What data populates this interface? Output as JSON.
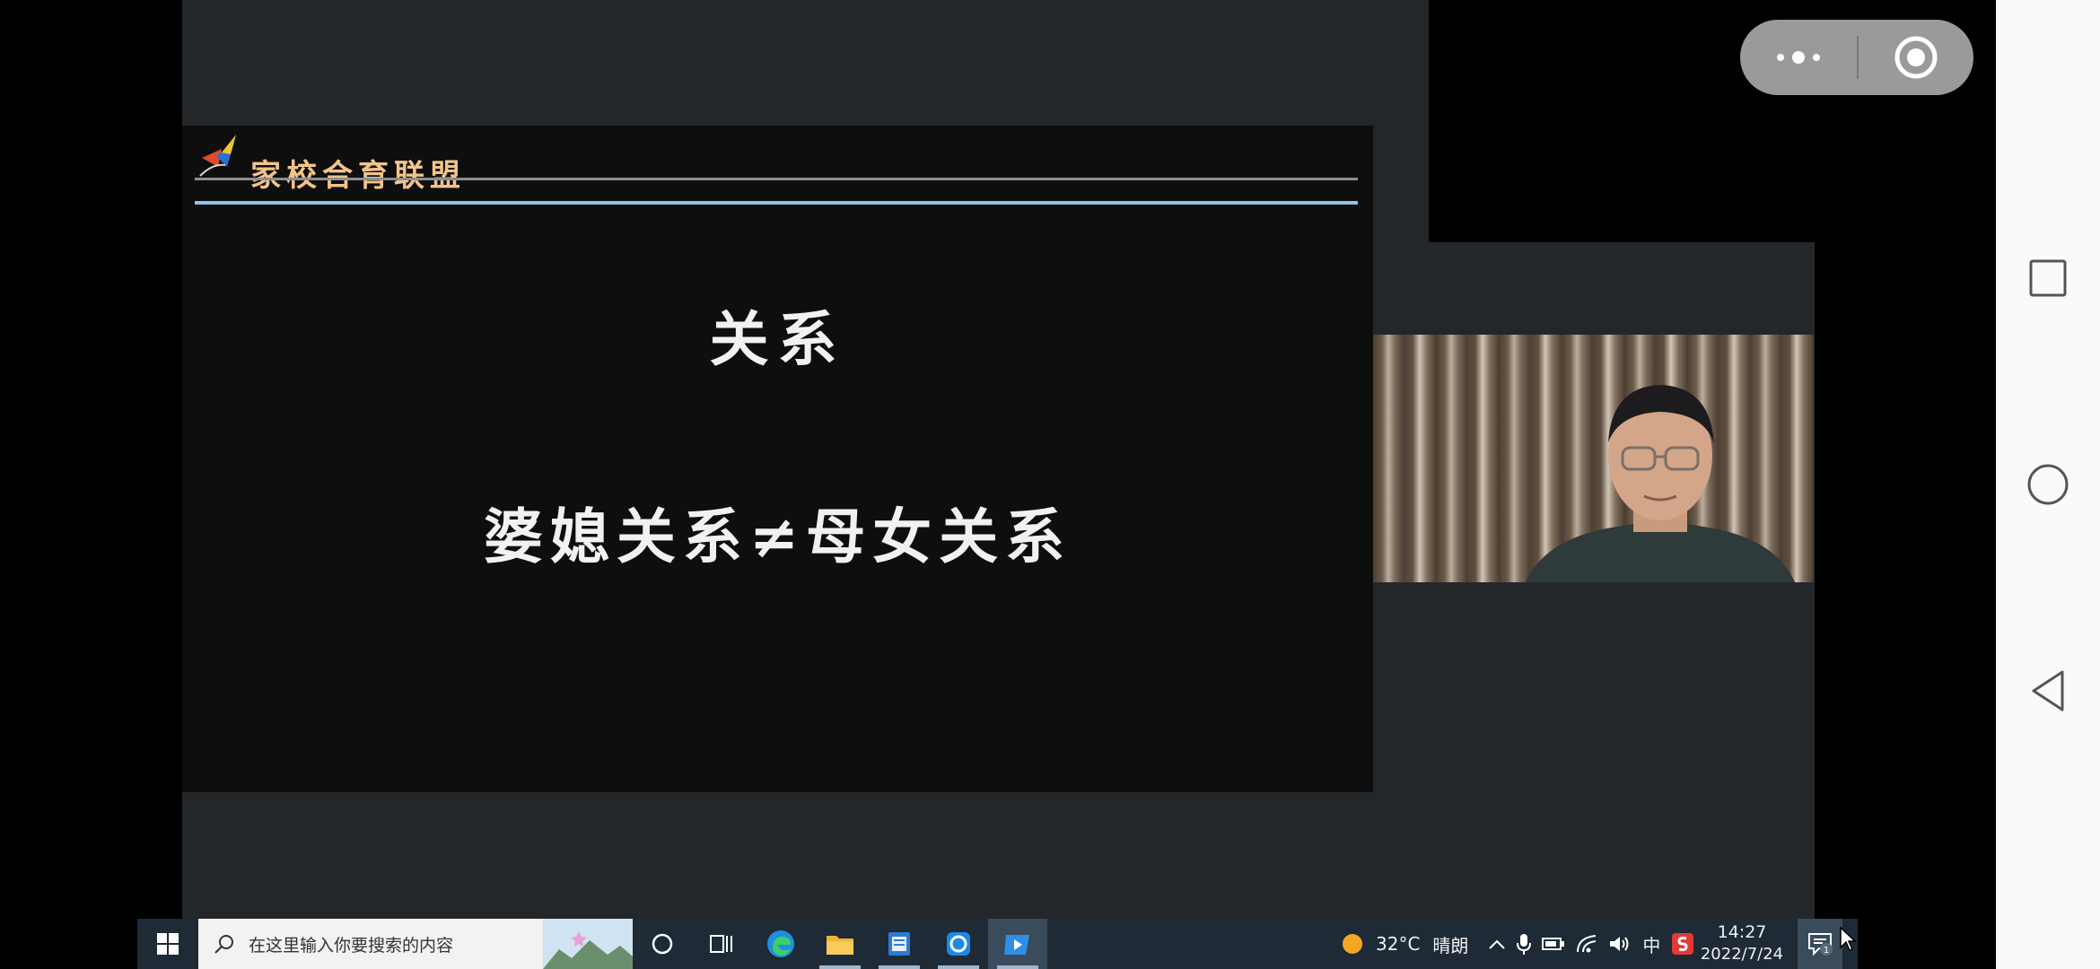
{
  "slide": {
    "header": "家校合育联盟",
    "title": "关系",
    "subtitle": "婆媳关系≠母女关系"
  },
  "taskbar": {
    "search_placeholder": "在这里输入你要搜索的内容",
    "weather_temp": "32°C",
    "weather_text": "晴朗",
    "ime": "中",
    "clock_time": "14:27",
    "clock_date": "2022/7/24",
    "notification_count": "1"
  },
  "icons": {
    "start": "windows-logo-icon",
    "search": "search-icon",
    "cortana": "cortana-circle-icon",
    "task_view": "task-view-icon",
    "edge": "edge-browser-icon",
    "explorer": "file-explorer-icon",
    "notepad": "notepad-icon",
    "app_blue": "blue-app-icon",
    "media_app": "media-player-icon",
    "weather": "sun-icon",
    "wps": "wps-icon"
  },
  "colors": {
    "slide_bg": "#0e0e0e",
    "header_text": "#f3c48a",
    "accent_rule": "#8fc3e8",
    "taskbar": "#1e2a36"
  }
}
